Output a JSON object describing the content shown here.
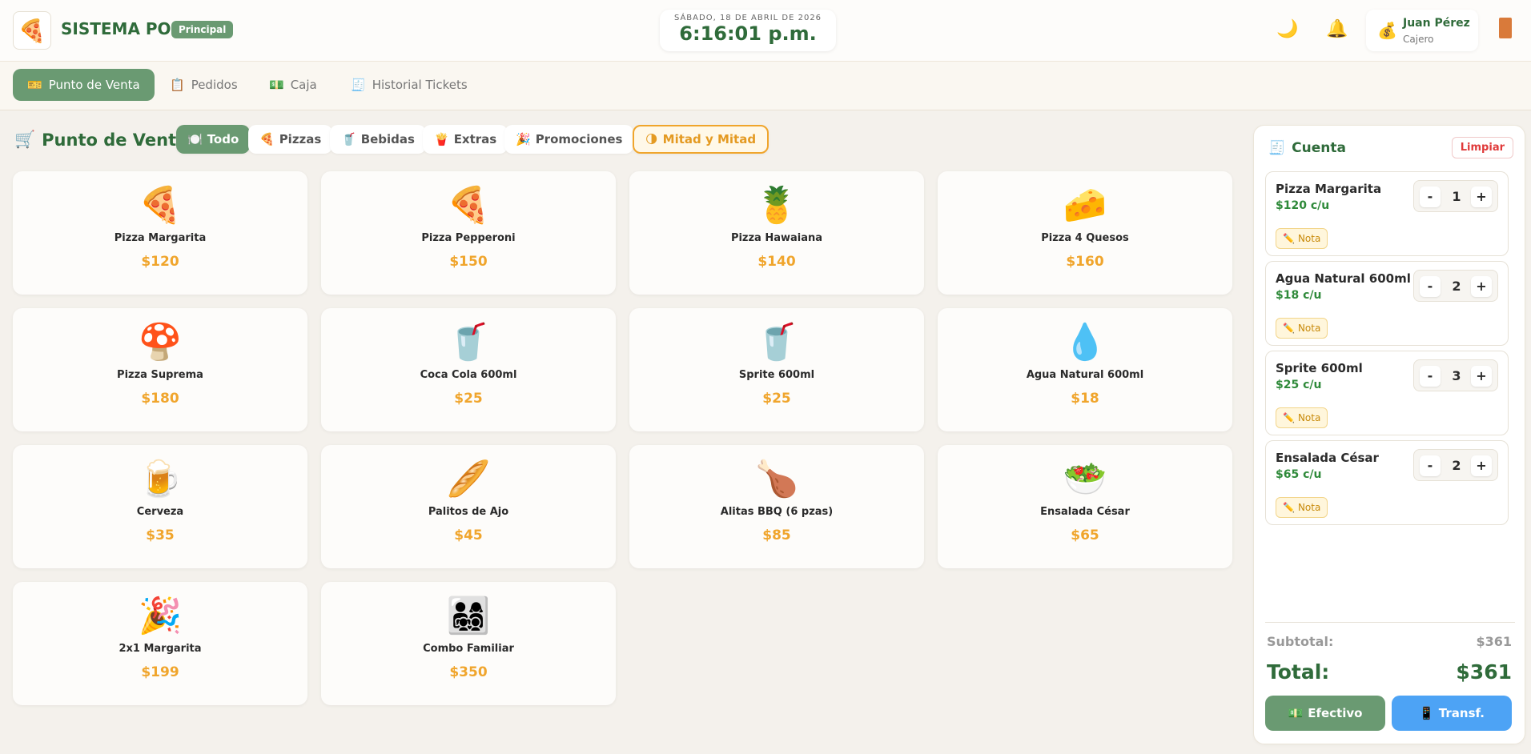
{
  "header": {
    "logo_icon": "pizza-logo",
    "brand": "SISTEMA POS",
    "badge": "Principal",
    "date": "SÁBADO, 18 DE ABRIL DE 2026",
    "time": "6:16:01 p.m.",
    "user_name": "Juan Pérez",
    "user_role": "Cajero"
  },
  "nav": {
    "tabs": [
      {
        "icon": "🎫",
        "label": "Punto de Venta"
      },
      {
        "icon": "📋",
        "label": "Pedidos"
      },
      {
        "icon": "💵",
        "label": "Caja"
      },
      {
        "icon": "🧾",
        "label": "Historial Tickets"
      }
    ]
  },
  "pos": {
    "title": "Punto de Venta",
    "title_icon": "🛒",
    "categories": [
      {
        "icon": "🍽️",
        "label": "Todo"
      },
      {
        "icon": "🍕",
        "label": "Pizzas"
      },
      {
        "icon": "🥤",
        "label": "Bebidas"
      },
      {
        "icon": "🍟",
        "label": "Extras"
      },
      {
        "icon": "🎉",
        "label": "Promociones"
      },
      {
        "icon": "🌗",
        "label": "Mitad y Mitad"
      }
    ],
    "products": [
      {
        "emoji": "🍕",
        "name": "Pizza Margarita",
        "price": "$120"
      },
      {
        "emoji": "🍕",
        "name": "Pizza Pepperoni",
        "price": "$150"
      },
      {
        "emoji": "🍍",
        "name": "Pizza Hawaiana",
        "price": "$140"
      },
      {
        "emoji": "🧀",
        "name": "Pizza 4 Quesos",
        "price": "$160"
      },
      {
        "emoji": "🍄",
        "name": "Pizza Suprema",
        "price": "$180"
      },
      {
        "emoji": "🥤",
        "name": "Coca Cola 600ml",
        "price": "$25"
      },
      {
        "emoji": "🥤",
        "name": "Sprite 600ml",
        "price": "$25"
      },
      {
        "emoji": "💧",
        "name": "Agua Natural 600ml",
        "price": "$18"
      },
      {
        "emoji": "🍺",
        "name": "Cerveza",
        "price": "$35"
      },
      {
        "emoji": "🥖",
        "name": "Palitos de Ajo",
        "price": "$45"
      },
      {
        "emoji": "🍗",
        "name": "Alitas BBQ (6 pzas)",
        "price": "$85"
      },
      {
        "emoji": "🥗",
        "name": "Ensalada César",
        "price": "$65"
      },
      {
        "emoji": "🎉",
        "name": "2x1 Margarita",
        "price": "$199"
      },
      {
        "emoji": "👨‍👩‍👧‍👦",
        "name": "Combo Familiar",
        "price": "$350"
      }
    ]
  },
  "order": {
    "title": "Cuenta",
    "title_icon": "🧾",
    "clear_label": "Limpiar",
    "note_label": "Nota",
    "items": [
      {
        "name": "Pizza Margarita",
        "unit_price": "$120 c/u",
        "qty": "1"
      },
      {
        "name": "Agua Natural 600ml",
        "unit_price": "$18 c/u",
        "qty": "2"
      },
      {
        "name": "Sprite 600ml",
        "unit_price": "$25 c/u",
        "qty": "3"
      },
      {
        "name": "Ensalada César",
        "unit_price": "$65 c/u",
        "qty": "2"
      }
    ],
    "subtotal_label": "Subtotal:",
    "subtotal": "$361",
    "total_label": "Total:",
    "total": "$361",
    "pay_cash_label": "Efectivo",
    "pay_cash_icon": "💵",
    "pay_transfer_label": "Transf.",
    "pay_transfer_icon": "📱"
  },
  "colors": {
    "brand_green": "#2f6b3a",
    "accent_green": "#6a9a72",
    "price_orange": "#f0a52c",
    "transfer_blue": "#4da3f5",
    "danger_red": "#e03a3a"
  }
}
